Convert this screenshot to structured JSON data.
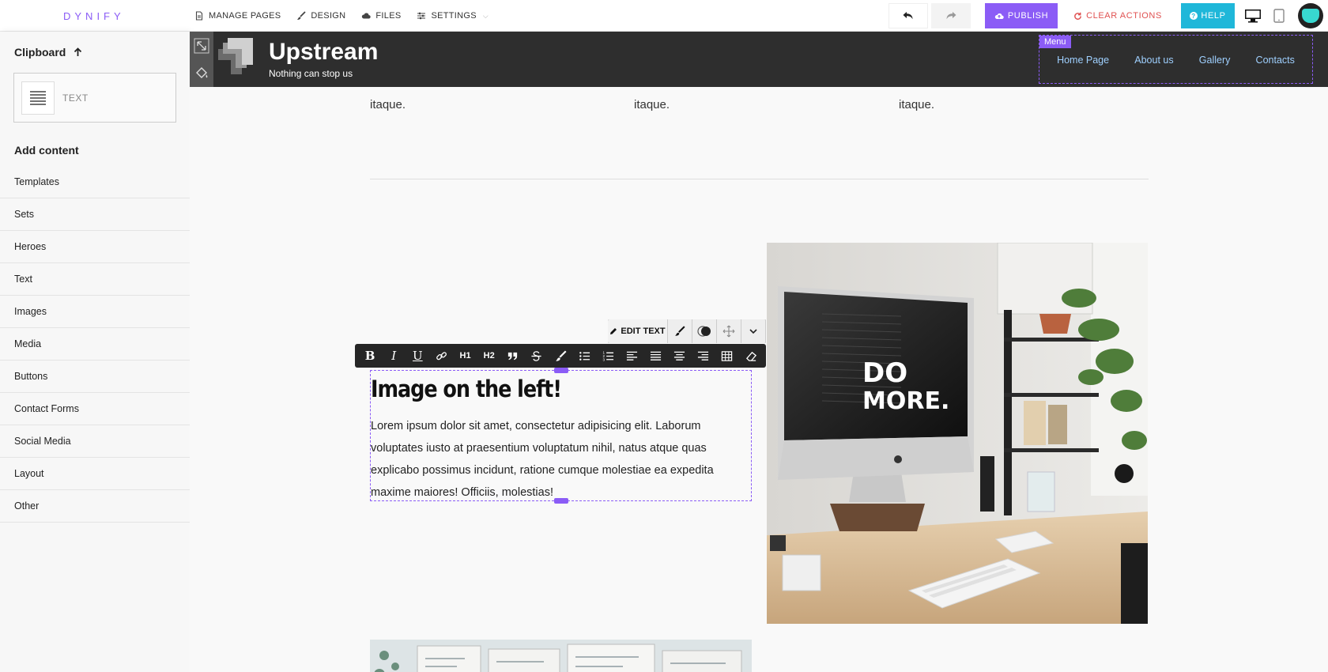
{
  "app": {
    "brand": "DYNIFY"
  },
  "topnav": [
    {
      "label": "MANAGE PAGES",
      "icon": "page-icon"
    },
    {
      "label": "DESIGN",
      "icon": "brush-icon"
    },
    {
      "label": "FILES",
      "icon": "cloud-icon"
    },
    {
      "label": "SETTINGS",
      "icon": "sliders-icon"
    }
  ],
  "toolbar": {
    "publish": "PUBLISH",
    "clear_actions": "CLEAR ACTIONS",
    "help": "HELP"
  },
  "colors": {
    "accent": "#8b5cf6",
    "help": "#1fb7d9",
    "danger": "#e05252",
    "header_bg": "#2e2e2e",
    "menu_link": "#9fd0ff"
  },
  "sidebar": {
    "clipboard_title": "Clipboard",
    "clipboard_item": "TEXT",
    "add_content_title": "Add content",
    "items": [
      "Templates",
      "Sets",
      "Heroes",
      "Text",
      "Images",
      "Media",
      "Buttons",
      "Contact Forms",
      "Social Media",
      "Layout",
      "Other"
    ]
  },
  "site": {
    "title": "Upstream",
    "tagline": "Nothing can stop us",
    "menu_tag": "Menu",
    "menu_links": [
      "Home Page",
      "About us",
      "Gallery",
      "Contacts"
    ]
  },
  "content": {
    "column_tail": "itaque.",
    "edit_text": "EDIT TEXT",
    "heading": "Image on the left!",
    "body": "Lorem ipsum dolor sit amet, consectetur adipisicing elit. Laborum voluptates iusto at praesentium voluptatum nihil, natus atque quas explicabo possimus incidunt, ratione cumque molestiae ea expedita maxime maiores! Officiis, molestias!"
  },
  "photo": {
    "screen_text_line1": "DO",
    "screen_text_line2": "MORE."
  }
}
